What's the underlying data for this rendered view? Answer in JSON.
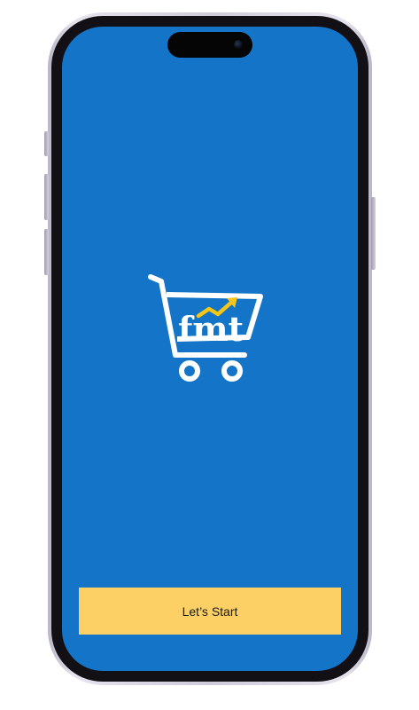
{
  "app": {
    "logo_text": "fmt",
    "logo_icon": "shopping-cart-trend-icon",
    "background_color": "#1374c8",
    "accent_color": "#f5c518"
  },
  "actions": {
    "start_label": "Let’s Start",
    "start_button_color": "#fcd065"
  }
}
